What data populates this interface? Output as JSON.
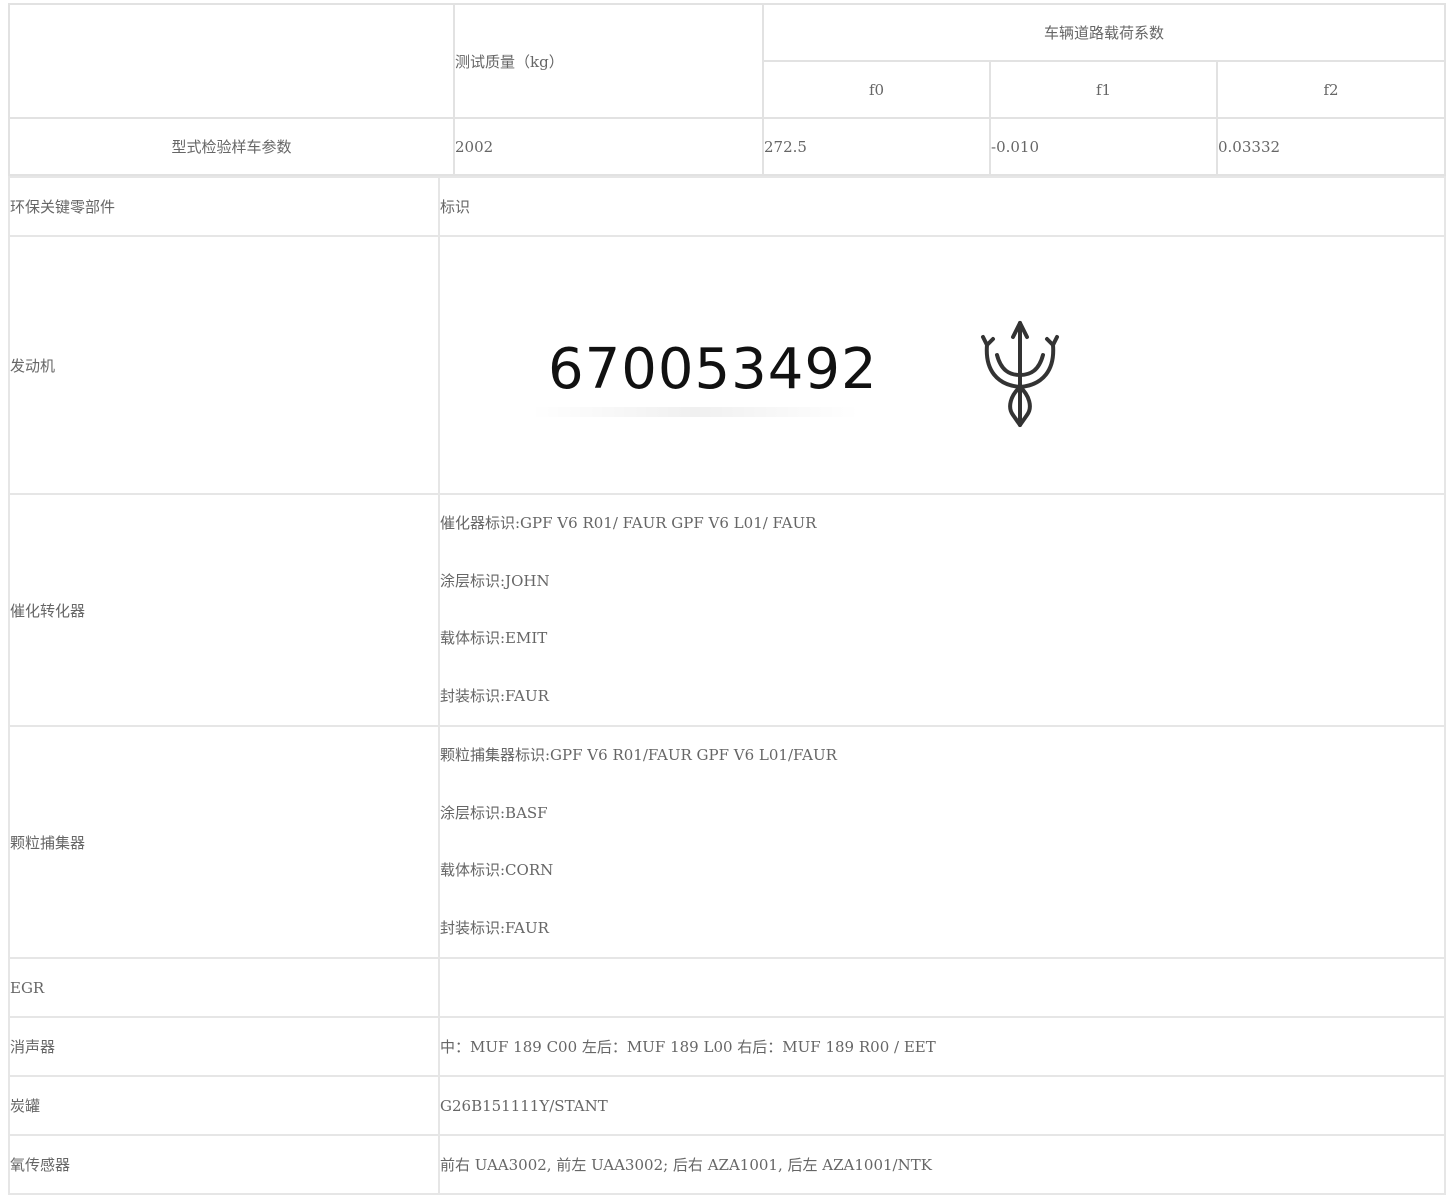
{
  "top_table": {
    "header_mass": "测试质量（kg）",
    "header_coeff": "车辆道路载荷系数",
    "sub_headers": [
      "f0",
      "f1",
      "f2"
    ],
    "row": {
      "label": "型式检验样车参数",
      "mass": "2002",
      "f0": "272.5",
      "f1": "-0.010",
      "f2": "0.03332"
    }
  },
  "main_table": {
    "header": {
      "part": "环保关键零部件",
      "mark": "标识"
    },
    "engine": {
      "label": "发动机",
      "number": "670053492",
      "logo_icon": "trident-logo-icon"
    },
    "catalyst": {
      "label": "催化转化器",
      "lines": [
        "催化器标识:GPF V6 R01/ FAUR GPF V6 L01/ FAUR",
        "涂层标识:JOHN",
        "载体标识:EMIT",
        "封装标识:FAUR"
      ]
    },
    "gpf": {
      "label": "颗粒捕集器",
      "lines": [
        "颗粒捕集器标识:GPF V6 R01/FAUR GPF V6 L01/FAUR",
        "涂层标识:BASF",
        "载体标识:CORN",
        "封装标识:FAUR"
      ]
    },
    "egr": {
      "label": "EGR",
      "value": ""
    },
    "muffler": {
      "label": "消声器",
      "value": "中：MUF 189 C00 左后：MUF 189 L00 右后：MUF 189 R00 / EET"
    },
    "canister": {
      "label": "炭罐",
      "value": "G26B151111Y/STANT"
    },
    "o2": {
      "label": "氧传感器",
      "value": "前右 UAA3002, 前左 UAA3002; 后右 AZA1001, 后左 AZA1001/NTK"
    }
  }
}
